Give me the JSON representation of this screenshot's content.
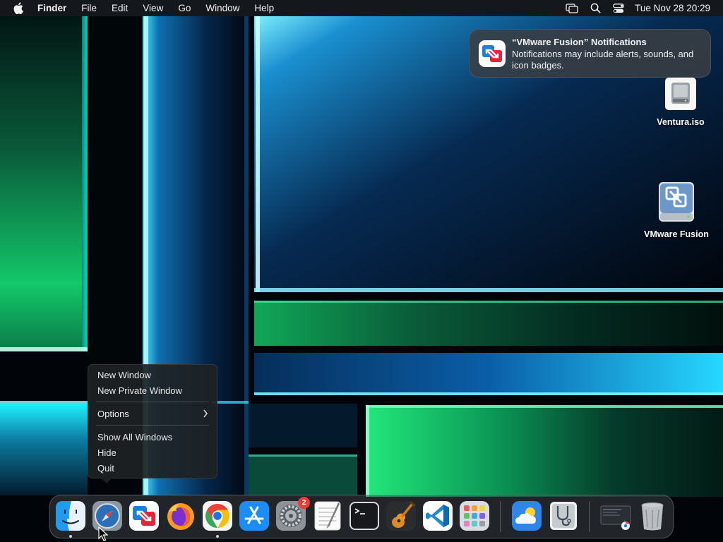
{
  "menubar": {
    "app_name": "Finder",
    "menus": [
      "File",
      "Edit",
      "View",
      "Go",
      "Window",
      "Help"
    ],
    "status_icons": [
      "screen-mirroring-icon",
      "spotlight-search-icon",
      "control-center-icon"
    ],
    "clock": "Tue Nov 28  20:29"
  },
  "notification": {
    "title": "“VMware Fusion” Notifications",
    "body": "Notifications may include alerts, sounds, and icon badges.",
    "icon": "vmware-fusion-icon"
  },
  "desktop": {
    "icons": [
      {
        "label": "Ventura.iso",
        "icon": "disk-image-icon"
      },
      {
        "label": "VMware Fusion",
        "icon": "vmware-fusion-volume-icon"
      }
    ]
  },
  "context_menu": {
    "items": {
      "new_window": "New Window",
      "new_private_window": "New Private Window",
      "options": "Options",
      "show_all_windows": "Show All Windows",
      "hide": "Hide",
      "quit": "Quit"
    }
  },
  "dock": {
    "apps": [
      {
        "name": "Finder",
        "icon": "finder-icon",
        "running": true
      },
      {
        "name": "Safari",
        "icon": "safari-icon",
        "running": false
      },
      {
        "name": "VMware Fusion",
        "icon": "vmware-fusion-icon",
        "running": false
      },
      {
        "name": "Firefox",
        "icon": "firefox-icon",
        "running": false
      },
      {
        "name": "Google Chrome",
        "icon": "chrome-icon",
        "running": true
      },
      {
        "name": "App Store",
        "icon": "app-store-icon",
        "running": false
      },
      {
        "name": "System Settings",
        "icon": "system-settings-icon",
        "running": false,
        "badge": "2"
      },
      {
        "name": "TextEdit",
        "icon": "textedit-icon",
        "running": false
      },
      {
        "name": "Terminal",
        "icon": "terminal-icon",
        "running": false
      },
      {
        "name": "GarageBand",
        "icon": "garageband-icon",
        "running": false
      },
      {
        "name": "Visual Studio Code",
        "icon": "vscode-icon",
        "running": false
      },
      {
        "name": "Launchpad",
        "icon": "launchpad-icon",
        "running": false
      },
      {
        "name": "Weather",
        "icon": "weather-icon",
        "running": false
      },
      {
        "name": "Disk Utility",
        "icon": "disk-utility-icon",
        "running": false
      },
      {
        "name": "Downloads",
        "icon": "downloads-stack-icon",
        "running": false
      },
      {
        "name": "Trash",
        "icon": "trash-icon",
        "running": false
      }
    ]
  },
  "colors": {
    "accent_teal": "#16e0d4",
    "accent_green": "#14d46a",
    "menu_bg": "#1e2124",
    "badge_red": "#ea3d33"
  }
}
